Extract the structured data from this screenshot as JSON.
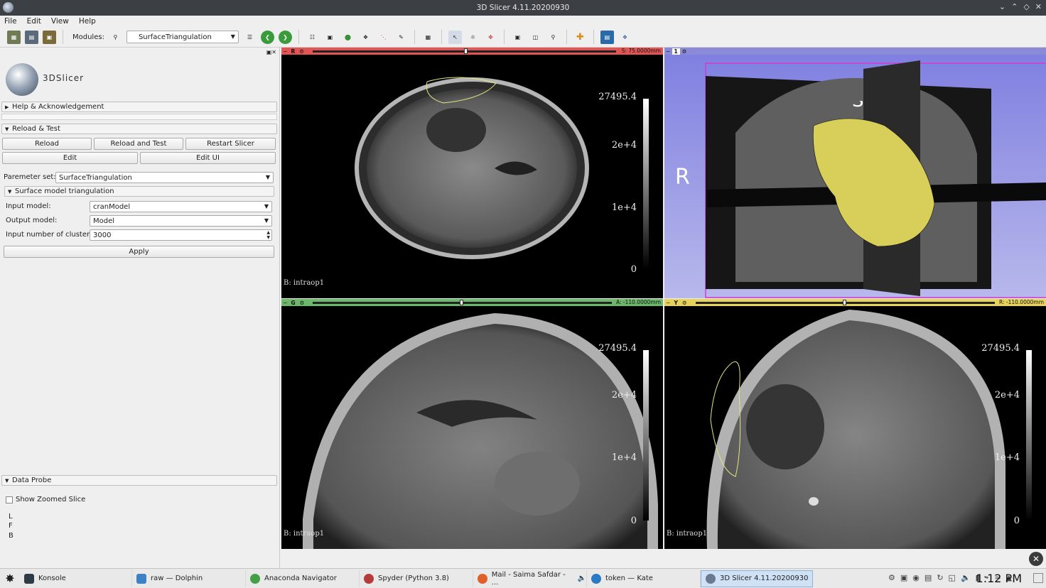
{
  "window": {
    "title": "3D Slicer 4.11.20200930"
  },
  "menu": [
    "File",
    "Edit",
    "View",
    "Help"
  ],
  "toolbar": {
    "icons": [
      "data-icon",
      "dcm-icon",
      "save-icon"
    ],
    "modules_label": "Modules:",
    "module_selected": "SurfaceTriangulation"
  },
  "left": {
    "logo_text": "3DSlicer",
    "help_section": "Help & Acknowledgement",
    "reload_section": "Reload & Test",
    "buttons": {
      "reload": "Reload",
      "reload_test": "Reload and Test",
      "restart": "Restart Slicer",
      "edit": "Edit",
      "edit_ui": "Edit UI"
    },
    "param_label": "Paremeter set:",
    "param_value": "SurfaceTriangulation",
    "surface_section": "Surface model triangulation",
    "input_model_label": "Input model:",
    "input_model_value": "cranModel",
    "output_model_label": "Output model:",
    "output_model_value": "Model",
    "clusters_label": "Input number of clusters:",
    "clusters_value": "3000",
    "apply": "Apply",
    "data_probe_section": "Data Probe",
    "show_zoomed": "Show Zoomed Slice",
    "probe_lines": [
      "L",
      "F",
      "B"
    ]
  },
  "views": {
    "red": {
      "badge": "R",
      "offset": "S: 75.0000mm",
      "label": "B: intraop1",
      "color": "#e25555",
      "slider_pos": 0.5
    },
    "three_d": {
      "badge": "1",
      "axis_r": "R",
      "axis_s": "S",
      "color": "#8a8ad8"
    },
    "green": {
      "badge": "G",
      "offset": "A: -110.0000mm",
      "label": "B: intraop1",
      "color": "#6bb86b",
      "slider_pos": 0.5
    },
    "yellow": {
      "badge": "Y",
      "offset": "R: -110.0000mm",
      "label": "B: intraop1",
      "color": "#e8d35a",
      "slider_pos": 0.5
    },
    "scale": {
      "max": "27495.4",
      "t2": "2e+4",
      "t1": "1e+4",
      "zero": "0"
    }
  },
  "taskbar": {
    "items": [
      {
        "label": "Konsole",
        "color": "#2e3b45"
      },
      {
        "label": "raw — Dolphin",
        "color": "#3d82c4"
      },
      {
        "label": "Anaconda Navigator",
        "color": "#43a047"
      },
      {
        "label": "Spyder (Python 3.8)",
        "color": "#b53c3c"
      },
      {
        "label": "Mail - Saima Safdar - ...",
        "color": "#e0602b"
      },
      {
        "label": "token — Kate",
        "color": "#2b7ac4"
      },
      {
        "label": "3D Slicer 4.11.20200930",
        "color": "#6a7a90"
      }
    ],
    "clock": "1:12 PM"
  }
}
